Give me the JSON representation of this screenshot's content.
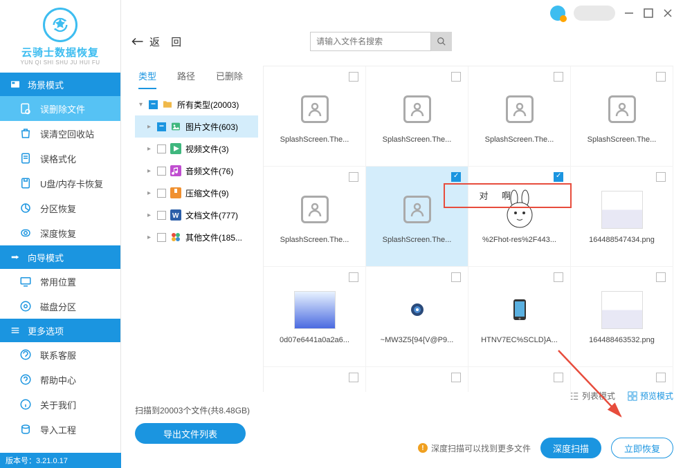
{
  "app": {
    "name": "云骑士数据恢复",
    "pinyin": "YUN QI SHI SHU JU HUI FU",
    "version_label": "版本号：3.21.0.17"
  },
  "sidebar": {
    "sections": {
      "scene": "场景模式",
      "wizard": "向导模式",
      "more": "更多选项"
    },
    "scene_items": [
      "误删除文件",
      "误清空回收站",
      "误格式化",
      "U盘/内存卡恢复",
      "分区恢复",
      "深度恢复"
    ],
    "wizard_items": [
      "常用位置",
      "磁盘分区"
    ],
    "more_items": [
      "联系客服",
      "帮助中心",
      "关于我们",
      "导入工程"
    ]
  },
  "header": {
    "back": "返  回",
    "search_placeholder": "请输入文件名搜索"
  },
  "tabs": [
    "类型",
    "路径",
    "已删除"
  ],
  "tree": [
    {
      "label": "所有类型(20003)",
      "filled": true,
      "icon": "folder"
    },
    {
      "label": "图片文件(603)",
      "filled": true,
      "icon": "image",
      "selected": true
    },
    {
      "label": "视频文件(3)",
      "icon": "video"
    },
    {
      "label": "音频文件(76)",
      "icon": "audio"
    },
    {
      "label": "压缩文件(9)",
      "icon": "archive"
    },
    {
      "label": "文档文件(777)",
      "icon": "doc"
    },
    {
      "label": "其他文件(185...",
      "icon": "other"
    }
  ],
  "grid": [
    {
      "name": "SplashScreen.The...",
      "type": "person"
    },
    {
      "name": "SplashScreen.The...",
      "type": "person"
    },
    {
      "name": "SplashScreen.The...",
      "type": "person"
    },
    {
      "name": "SplashScreen.The...",
      "type": "person"
    },
    {
      "name": "SplashScreen.The...",
      "type": "person"
    },
    {
      "name": "SplashScreen.The...",
      "type": "person",
      "selected": true,
      "checked": true
    },
    {
      "name": "%2Fhot-res%2F443...",
      "type": "rabbit",
      "checked": true,
      "annotation": "对 啊"
    },
    {
      "name": "164488547434.png",
      "type": "ss"
    },
    {
      "name": "0d07e6441a0a2a6...",
      "type": "blue"
    },
    {
      "name": "~MW3Z5{94{V@P9...",
      "type": "cam"
    },
    {
      "name": "HTNV7EC%SCLD}A...",
      "type": "phone"
    },
    {
      "name": "164488463532.png",
      "type": "ss"
    },
    {
      "name": "",
      "type": "blank"
    },
    {
      "name": "",
      "type": "banner"
    },
    {
      "name": "",
      "type": "blank2"
    },
    {
      "name": "",
      "type": "blank2"
    }
  ],
  "view_modes": {
    "list": "列表模式",
    "preview": "预览模式"
  },
  "footer": {
    "scan_info": "扫描到20003个文件(共8.48GB)",
    "export": "导出文件列表",
    "deep_hint": "深度扫描可以找到更多文件",
    "deep_scan": "深度扫描",
    "restore": "立即恢复"
  }
}
